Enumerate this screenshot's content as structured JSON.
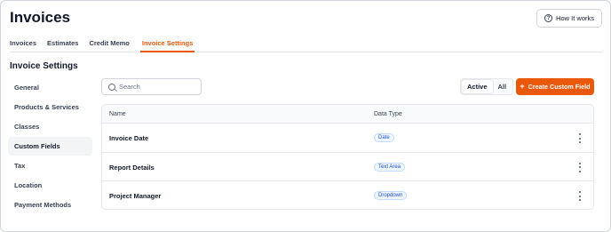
{
  "header": {
    "title": "Invoices",
    "help_button": "How It works",
    "help_icon": "question-circle-icon"
  },
  "tabs": [
    {
      "label": "Invoices",
      "active": false
    },
    {
      "label": "Estimates",
      "active": false
    },
    {
      "label": "Credit Memo",
      "active": false
    },
    {
      "label": "Invoice Settings",
      "active": true
    }
  ],
  "section_title": "Invoice Settings",
  "sidebar": {
    "items": [
      {
        "label": "General",
        "active": false
      },
      {
        "label": "Products & Services",
        "active": false
      },
      {
        "label": "Classes",
        "active": false
      },
      {
        "label": "Custom Fields",
        "active": true
      },
      {
        "label": "Tax",
        "active": false
      },
      {
        "label": "Location",
        "active": false
      },
      {
        "label": "Payment Methods",
        "active": false
      }
    ]
  },
  "search": {
    "placeholder": "Search",
    "value": ""
  },
  "filter": {
    "options": [
      "Active",
      "All"
    ],
    "selected": "Active"
  },
  "create_button": {
    "label": "Create Custom Field",
    "icon": "plus-icon"
  },
  "table": {
    "columns": [
      "Name",
      "Data Type"
    ],
    "rows": [
      {
        "name": "Invoice Date",
        "type": "Date"
      },
      {
        "name": "Report Details",
        "type": "Text Area"
      },
      {
        "name": "Project Manager",
        "type": "Dropdown"
      }
    ]
  },
  "colors": {
    "accent": "#ea580c",
    "badge_text": "#1d4ed8",
    "badge_bg": "#eff6ff"
  }
}
